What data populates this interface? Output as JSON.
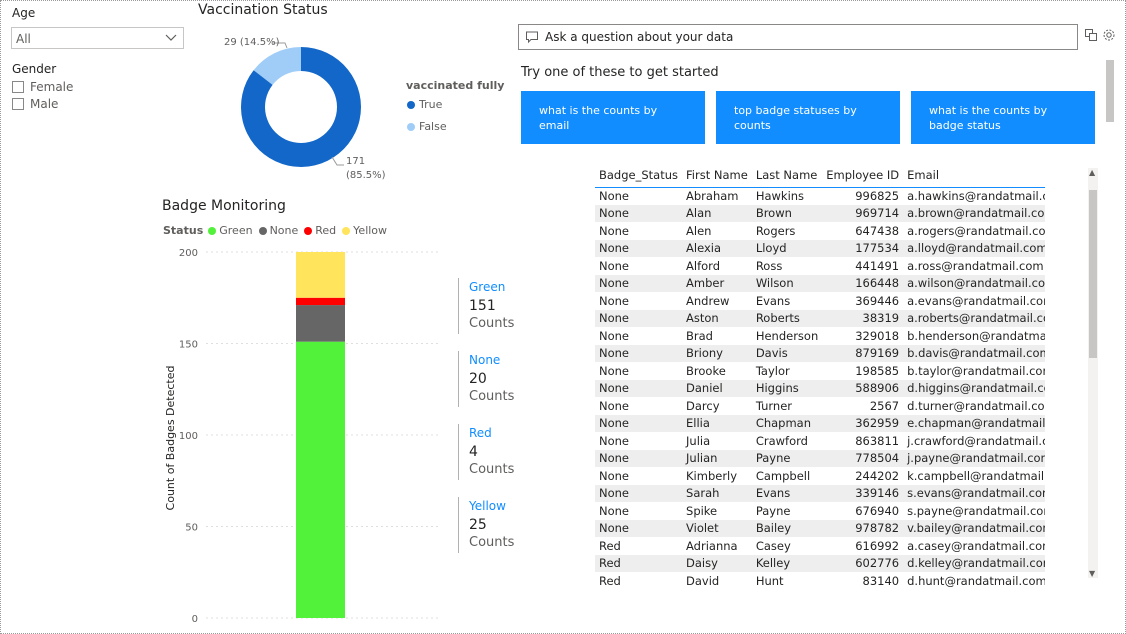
{
  "filters": {
    "age": {
      "title": "Age",
      "value": "All"
    },
    "gender": {
      "title": "Gender",
      "options": [
        "Female",
        "Male"
      ]
    }
  },
  "vaccination": {
    "title": "Vaccination Status",
    "legend_title": "vaccinated fully",
    "legend": [
      {
        "name": "True",
        "color": "#1267c8"
      },
      {
        "name": "False",
        "color": "#9fcdf8"
      }
    ],
    "labels": {
      "false_label": "29 (14.5%)",
      "true_count": "171",
      "true_pct": "(85.5%)"
    },
    "chart_data": {
      "type": "pie",
      "donut": true,
      "categories": [
        "True",
        "False"
      ],
      "values": [
        171,
        29
      ],
      "percent": [
        85.5,
        14.5
      ],
      "colors": [
        "#1267c8",
        "#9fcdf8"
      ]
    }
  },
  "badge": {
    "title": "Badge Monitoring",
    "legend_title": "Status",
    "legend": [
      {
        "name": "Green",
        "color": "#52f23a"
      },
      {
        "name": "None",
        "color": "#666666"
      },
      {
        "name": "Red",
        "color": "#ff0000"
      },
      {
        "name": "Yellow",
        "color": "#ffe45c"
      }
    ],
    "ylabel": "Count of Badges Detected",
    "yticks": [
      "200",
      "150",
      "100",
      "50",
      "0"
    ],
    "cards": [
      {
        "name": "Green",
        "value": "151",
        "unit": "Counts"
      },
      {
        "name": "None",
        "value": "20",
        "unit": "Counts"
      },
      {
        "name": "Red",
        "value": "4",
        "unit": "Counts"
      },
      {
        "name": "Yellow",
        "value": "25",
        "unit": "Counts"
      }
    ],
    "chart_data": {
      "type": "bar",
      "stacked": true,
      "categories": [
        ""
      ],
      "series": [
        {
          "name": "Green",
          "values": [
            151
          ]
        },
        {
          "name": "None",
          "values": [
            20
          ]
        },
        {
          "name": "Red",
          "values": [
            4
          ]
        },
        {
          "name": "Yellow",
          "values": [
            25
          ]
        }
      ],
      "ylabel": "Count of Badges Detected",
      "ylim": [
        0,
        200
      ],
      "grid": true,
      "legend": "top"
    }
  },
  "qa": {
    "placeholder": "Ask a question about your data",
    "prompt": "Try one of these to get started",
    "suggestions": [
      "what is the counts by email",
      "top badge statuses by counts",
      "what is the counts by badge status"
    ]
  },
  "table": {
    "columns": [
      "Badge_Status",
      "First Name",
      "Last Name",
      "Employee ID",
      "Email"
    ],
    "rows": [
      [
        "None",
        "Abraham",
        "Hawkins",
        "996825",
        "a.hawkins@randatmail.com"
      ],
      [
        "None",
        "Alan",
        "Brown",
        "969714",
        "a.brown@randatmail.com"
      ],
      [
        "None",
        "Alen",
        "Rogers",
        "647438",
        "a.rogers@randatmail.com"
      ],
      [
        "None",
        "Alexia",
        "Lloyd",
        "177534",
        "a.lloyd@randatmail.com"
      ],
      [
        "None",
        "Alford",
        "Ross",
        "441491",
        "a.ross@randatmail.com"
      ],
      [
        "None",
        "Amber",
        "Wilson",
        "166448",
        "a.wilson@randatmail.com"
      ],
      [
        "None",
        "Andrew",
        "Evans",
        "369446",
        "a.evans@randatmail.com"
      ],
      [
        "None",
        "Aston",
        "Roberts",
        "38319",
        "a.roberts@randatmail.com"
      ],
      [
        "None",
        "Brad",
        "Henderson",
        "329018",
        "b.henderson@randatmail.com"
      ],
      [
        "None",
        "Briony",
        "Davis",
        "879169",
        "b.davis@randatmail.com"
      ],
      [
        "None",
        "Brooke",
        "Taylor",
        "198585",
        "b.taylor@randatmail.com"
      ],
      [
        "None",
        "Daniel",
        "Higgins",
        "588906",
        "d.higgins@randatmail.com"
      ],
      [
        "None",
        "Darcy",
        "Turner",
        "2567",
        "d.turner@randatmail.com"
      ],
      [
        "None",
        "Ellia",
        "Chapman",
        "362959",
        "e.chapman@randatmail.com"
      ],
      [
        "None",
        "Julia",
        "Crawford",
        "863811",
        "j.crawford@randatmail.com"
      ],
      [
        "None",
        "Julian",
        "Payne",
        "778504",
        "j.payne@randatmail.com"
      ],
      [
        "None",
        "Kimberly",
        "Campbell",
        "244202",
        "k.campbell@randatmail.com"
      ],
      [
        "None",
        "Sarah",
        "Evans",
        "339146",
        "s.evans@randatmail.com"
      ],
      [
        "None",
        "Spike",
        "Payne",
        "676940",
        "s.payne@randatmail.com"
      ],
      [
        "None",
        "Violet",
        "Bailey",
        "978782",
        "v.bailey@randatmail.com"
      ],
      [
        "Red",
        "Adrianna",
        "Casey",
        "616992",
        "a.casey@randatmail.com"
      ],
      [
        "Red",
        "Daisy",
        "Kelley",
        "602776",
        "d.kelley@randatmail.com"
      ],
      [
        "Red",
        "David",
        "Hunt",
        "83140",
        "d.hunt@randatmail.com"
      ]
    ]
  }
}
